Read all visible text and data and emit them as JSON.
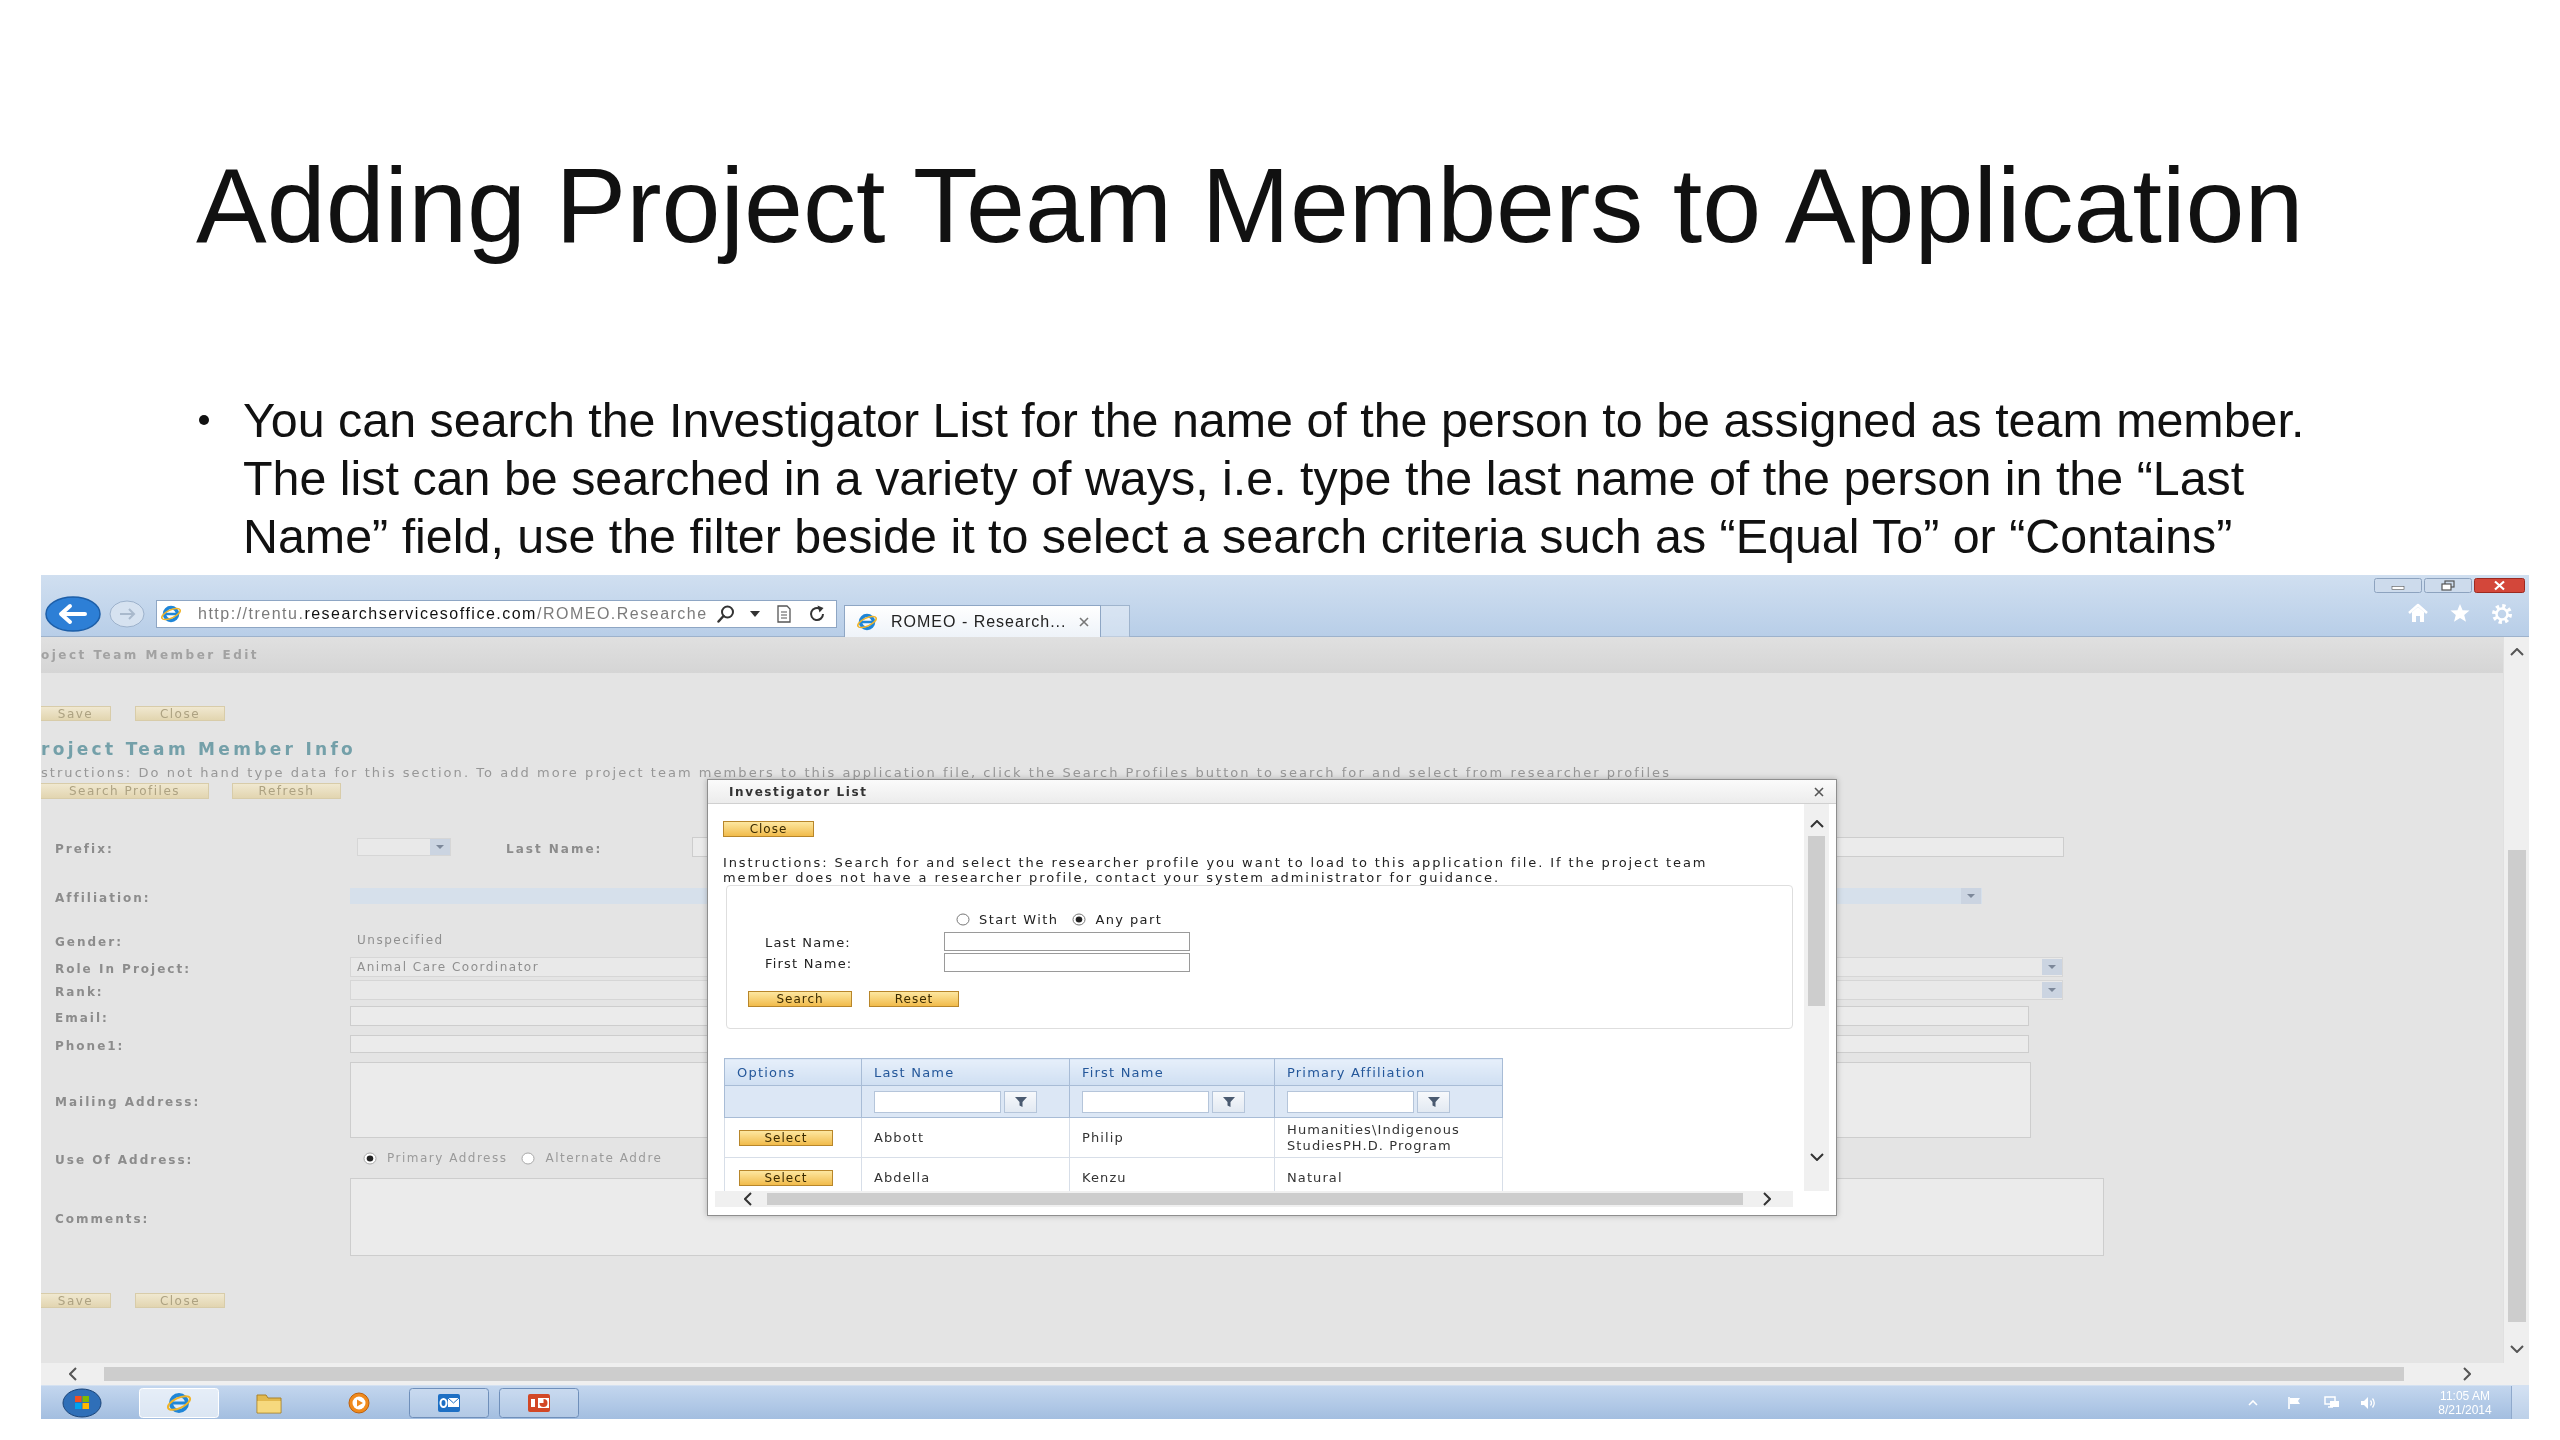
{
  "slide": {
    "title": "Adding Project Team Members to Application",
    "bullets": [
      "You can search the Investigator List for the name of the person to be assigned as team member. The list can be searched in a variety of ways, i.e. type the last name of the person in the “Last Name” field, use the filter beside it to select a search criteria such as “Equal To” or “Contains”"
    ]
  },
  "browser": {
    "address": "http://trentu.**researchservicesoffice.com**/ROMEO.Researche",
    "tabs": [
      {
        "title": "ROMEO - Research...",
        "selected": true
      }
    ]
  },
  "page": {
    "header": "oject Team Member Edit",
    "top_buttons": [
      "Save",
      "Close"
    ],
    "section_title": "roject Team Member Info",
    "instructions": "structions: Do not hand type data for this section. To add more project team members to this application file, click the Search Profiles button to search for and select from researcher profiles",
    "section_buttons": [
      "Search Profiles",
      "Refresh"
    ],
    "fields": [
      {
        "label": "Prefix:",
        "kind": "select",
        "side": {
          "label": "Last Name:",
          "kind": "text"
        }
      },
      {
        "label": "Affiliation:",
        "kind": "select"
      },
      {
        "label": "Gender:",
        "kind": "static",
        "value": "Unspecified"
      },
      {
        "label": "Role In Project:",
        "kind": "select",
        "value": "Animal Care Coordinator"
      },
      {
        "label": "Rank:",
        "kind": "select"
      },
      {
        "label": "Email:",
        "kind": "text"
      },
      {
        "label": "Phone1:",
        "kind": "text"
      },
      {
        "label": "Mailing Address:",
        "kind": "textarea"
      },
      {
        "label": "Use Of Address:",
        "kind": "radio",
        "options": [
          {
            "label": "Primary Address",
            "selected": true
          },
          {
            "label": "Alternate Addre",
            "selected": false
          }
        ]
      },
      {
        "label": "Comments:",
        "kind": "textarea"
      }
    ],
    "bottom_buttons": [
      "Save",
      "Close"
    ]
  },
  "dialog": {
    "title": "Investigator List",
    "close_button": "Close",
    "instructions": "Instructions: Search for and select the researcher profile you want to load to this application file. If the project team member does not have a researcher profile, contact your system administrator for guidance.",
    "match_options": [
      {
        "label": "Start With",
        "selected": false
      },
      {
        "label": "Any part",
        "selected": true
      }
    ],
    "search_fields": [
      {
        "label": "Last Name:"
      },
      {
        "label": "First Name:"
      }
    ],
    "buttons": [
      "Search",
      "Reset"
    ],
    "table": {
      "columns": [
        {
          "label": "Options",
          "filter": false,
          "kind": "button"
        },
        {
          "label": "Last Name",
          "filter": true,
          "kind": "text"
        },
        {
          "label": "First Name",
          "filter": true,
          "kind": "text"
        },
        {
          "label": "Primary Affiliation",
          "filter": true,
          "kind": "text"
        }
      ],
      "rows": [
        {
          "cells": [
            "Select",
            "Abbott",
            "Philip",
            "Humanities\\Indigenous StudiesPH.D. Program"
          ]
        },
        {
          "cells": [
            "Select",
            "Abdella",
            "Kenzu",
            "Natural"
          ]
        }
      ]
    }
  },
  "taskbar": {
    "apps": [
      {
        "kind": "browser",
        "running": true,
        "selected": true
      },
      {
        "kind": "folder",
        "running": false,
        "selected": false
      },
      {
        "kind": "media",
        "running": false,
        "selected": false
      },
      {
        "kind": "mail",
        "running": true,
        "selected": false
      },
      {
        "kind": "slides",
        "running": true,
        "selected": false
      }
    ],
    "time": "11:05 AM",
    "date": "8/21/2014"
  }
}
